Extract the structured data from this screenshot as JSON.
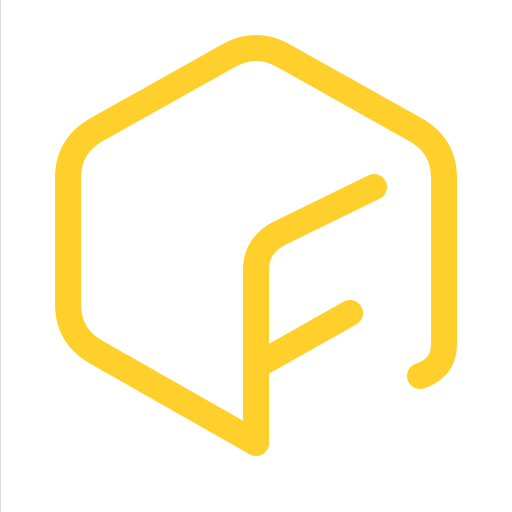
{
  "logo": {
    "icon": "hexagon-f-logo-icon",
    "color": "#FFD02B",
    "background": "#FFFFFF"
  }
}
